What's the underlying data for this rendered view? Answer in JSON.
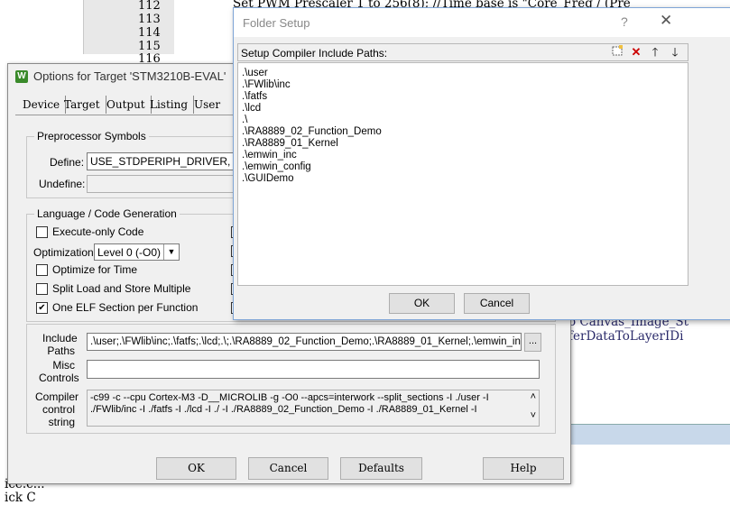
{
  "editor": {
    "line_numbers": [
      "112",
      "113",
      "114",
      "115",
      "116"
    ],
    "code_lines": [
      "Set PWM Prescaler 1 to 256(8); //Time base is \"Core_Freq / (Pre"
    ],
    "code_right_1": "o Canvas_Image_St",
    "code_right_2": "ferDataToLayerIDi",
    "code_bottom_1": "ice.c...",
    "code_bottom_2": "ick C"
  },
  "options_dialog": {
    "title": "Options for Target 'STM3210B-EVAL'",
    "icon_letter": "W",
    "tabs": [
      "Device",
      "Target",
      "Output",
      "Listing",
      "User"
    ],
    "preprocessor": {
      "group_label": "Preprocessor Symbols",
      "define_label": "Define:",
      "define_value": "USE_STDPERIPH_DRIVER, STM",
      "undefine_label": "Undefine:",
      "undefine_value": ""
    },
    "language": {
      "group_label": "Language / Code Generation",
      "execute_only": "Execute-only Code",
      "optimization_label": "Optimization:",
      "optimization_value": "Level 0 (-O0)",
      "optimize_time": "Optimize for Time",
      "split_load": "Split Load and Store Multiple",
      "one_elf": "One ELF Section per Function"
    },
    "include": {
      "label_line1": "Include",
      "label_line2": "Paths",
      "value": ".\\user;.\\FWlib\\inc;.\\fatfs;.\\lcd;.\\;.\\RA8889_02_Function_Demo;.\\RA8889_01_Kernel;.\\emwin_inc;.\\",
      "browse": "..."
    },
    "misc": {
      "label_line1": "Misc",
      "label_line2": "Controls",
      "value": ""
    },
    "compiler": {
      "label_line1": "Compiler",
      "label_line2": "control",
      "label_line3": "string",
      "line1": "-c99 -c --cpu Cortex-M3 -D__MICROLIB -g -O0 --apcs=interwork --split_sections -I ./user -I",
      "line2": "./FWlib/inc -I ./fatfs -I ./lcd -I ./ -I ./RA8889_02_Function_Demo -I ./RA8889_01_Kernel -I"
    },
    "buttons": {
      "ok": "OK",
      "cancel": "Cancel",
      "defaults": "Defaults",
      "help": "Help"
    }
  },
  "folder_setup": {
    "title": "Folder Setup",
    "help": "?",
    "close": "✕",
    "header_label": "Setup Compiler Include Paths:",
    "paths": [
      ".\\user",
      ".\\FWlib\\inc",
      ".\\fatfs",
      ".\\lcd",
      ".\\",
      ".\\RA8889_02_Function_Demo",
      ".\\RA8889_01_Kernel",
      ".\\emwin_inc",
      ".\\emwin_config",
      ".\\GUIDemo"
    ],
    "buttons": {
      "ok": "OK",
      "cancel": "Cancel"
    },
    "toolbar_colors": {
      "delete": "#cc0000"
    }
  }
}
